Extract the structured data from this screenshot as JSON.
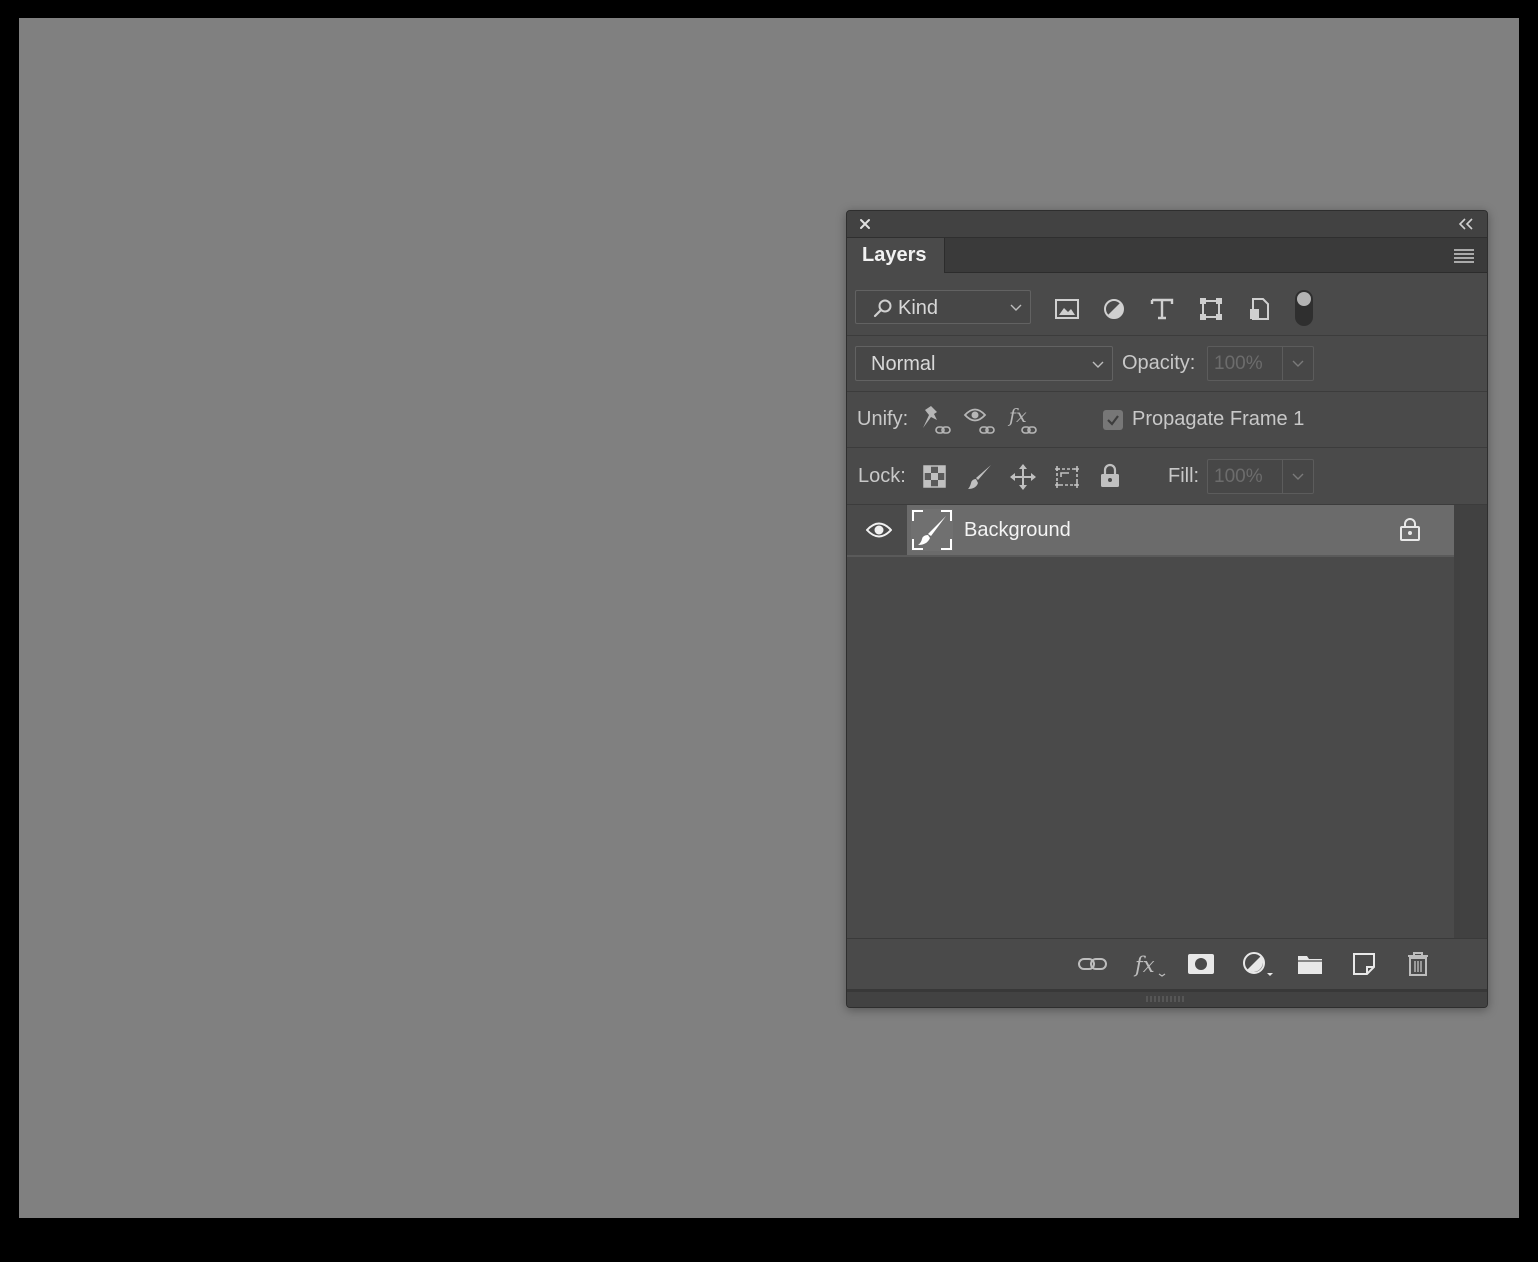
{
  "panel": {
    "tab_label": "Layers",
    "icons": {
      "close": "close-icon",
      "collapse": "collapse-chevrons-icon",
      "menu": "panel-menu-icon"
    }
  },
  "filter_row": {
    "kind_label": "Kind",
    "filter_icons": [
      "pixel-layer-filter-icon",
      "adjustment-layer-filter-icon",
      "type-layer-filter-icon",
      "shape-layer-filter-icon",
      "smart-object-filter-icon"
    ],
    "filter_toggle_on": true
  },
  "blend_row": {
    "blend_mode": "Normal",
    "opacity_label": "Opacity:",
    "opacity_value": "100%"
  },
  "unify_row": {
    "unify_label": "Unify:",
    "propagate_label": "Propagate Frame 1",
    "propagate_checked": true
  },
  "lock_row": {
    "lock_label": "Lock:",
    "fill_label": "Fill:",
    "fill_value": "100%"
  },
  "layers": [
    {
      "name": "Background",
      "visible": true,
      "locked": true
    }
  ],
  "footer_icons": [
    "link-layers-icon",
    "fx-icon",
    "add-mask-icon",
    "adjustment-icon",
    "new-group-icon",
    "new-layer-icon",
    "trash-icon"
  ],
  "colors": {
    "workspace": "#808080",
    "panel": "#4a4a4a",
    "selected_layer": "#6b6b6b"
  }
}
